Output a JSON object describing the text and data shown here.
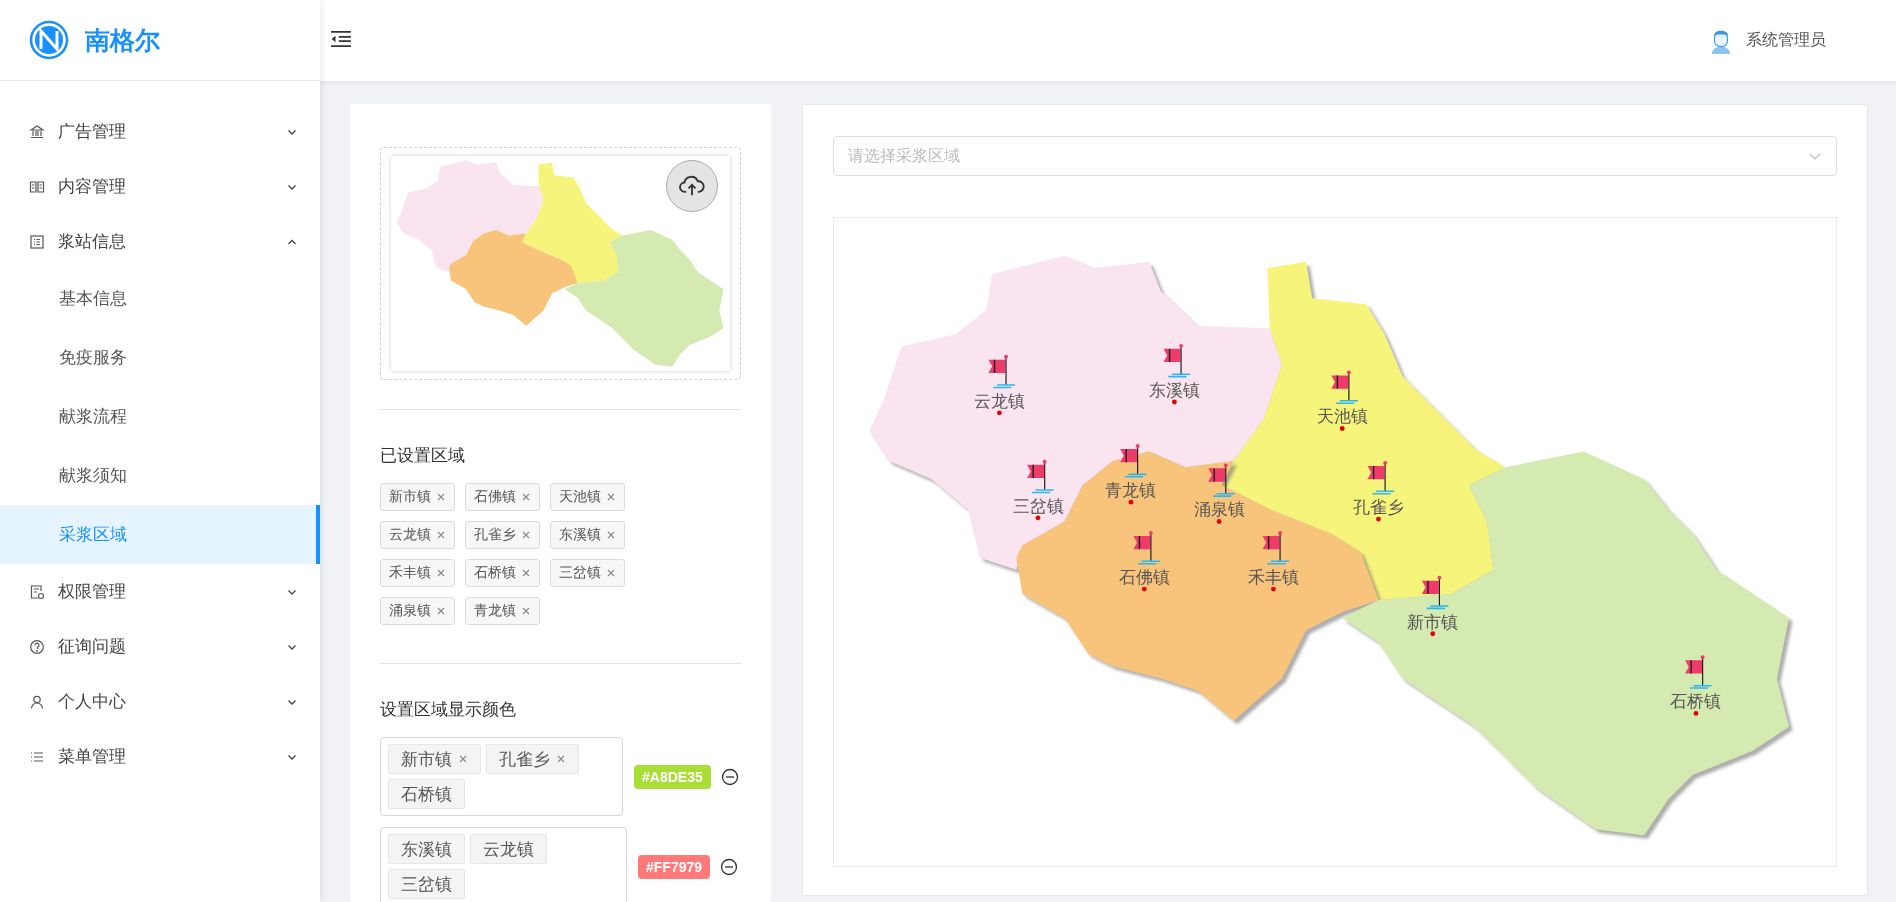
{
  "brand": {
    "name": "南格尔"
  },
  "user": {
    "name": "系统管理员"
  },
  "sidebar": {
    "items": [
      {
        "label": "广告管理",
        "expanded": false
      },
      {
        "label": "内容管理",
        "expanded": false
      },
      {
        "label": "浆站信息",
        "expanded": true,
        "children": [
          {
            "label": "基本信息",
            "selected": false
          },
          {
            "label": "免疫服务",
            "selected": false
          },
          {
            "label": "献浆流程",
            "selected": false
          },
          {
            "label": "献浆须知",
            "selected": false
          },
          {
            "label": "采浆区域",
            "selected": true
          }
        ]
      },
      {
        "label": "权限管理",
        "expanded": false
      },
      {
        "label": "征询问题",
        "expanded": false
      },
      {
        "label": "个人中心",
        "expanded": false
      },
      {
        "label": "菜单管理",
        "expanded": false
      }
    ]
  },
  "settings": {
    "registered_title": "已设置区域",
    "registered_tags": [
      "新市镇",
      "石佛镇",
      "天池镇",
      "云龙镇",
      "孔雀乡",
      "东溪镇",
      "禾丰镇",
      "石桥镇",
      "三岔镇",
      "涌泉镇",
      "青龙镇"
    ],
    "color_title": "设置区域显示颜色",
    "color_groups": [
      {
        "tags": [
          {
            "label": "新市镇",
            "removable": true
          },
          {
            "label": "孔雀乡",
            "removable": true
          },
          {
            "label": "石桥镇",
            "removable": false
          }
        ],
        "color": "#a8de35",
        "code": "#A8DE35"
      },
      {
        "tags": [
          {
            "label": "东溪镇",
            "removable": false
          },
          {
            "label": "云龙镇",
            "removable": false
          },
          {
            "label": "三岔镇",
            "removable": false
          }
        ],
        "color": "#ff7979",
        "code": "#FF7979"
      }
    ]
  },
  "map": {
    "select": {
      "placeholder": "请选择采浆区域"
    },
    "markers": [
      {
        "label": "云龙镇"
      },
      {
        "label": "东溪镇"
      },
      {
        "label": "天池镇"
      },
      {
        "label": "三岔镇"
      },
      {
        "label": "青龙镇"
      },
      {
        "label": "涌泉镇"
      },
      {
        "label": "孔雀乡"
      },
      {
        "label": "石佛镇"
      },
      {
        "label": "禾丰镇"
      },
      {
        "label": "新市镇"
      },
      {
        "label": "石桥镇"
      }
    ]
  }
}
